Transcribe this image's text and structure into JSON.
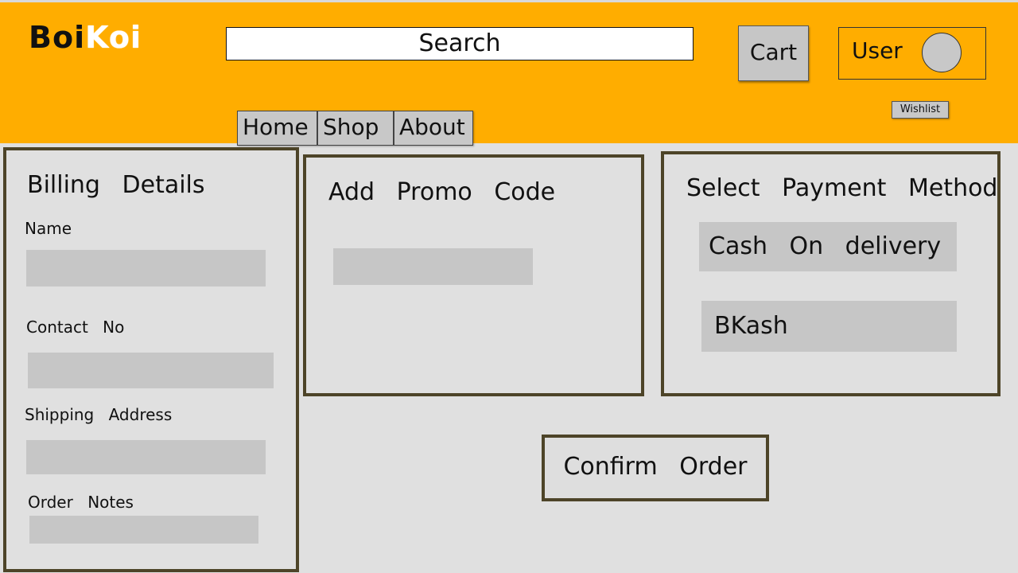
{
  "header": {
    "logo_part1": "Boi",
    "logo_part2": "Koi",
    "search_label": "Search",
    "cart_label": "Cart",
    "user_label": "User",
    "wishlist_label": "Wishlist",
    "nav": [
      "Home",
      "Shop",
      "About"
    ]
  },
  "billing": {
    "title": "Billing Details",
    "name_label": "Name",
    "contact_label": "Contact No",
    "address_label": "Shipping Address",
    "notes_label": "Order Notes"
  },
  "promo": {
    "title": "Add Promo Code"
  },
  "payment": {
    "title": "Select Payment Method",
    "options": [
      "Cash On delivery",
      "BKash"
    ]
  },
  "confirm_label": "Confirm Order",
  "colors": {
    "header_bg": "#ffad00",
    "page_bg": "#e0e0e0",
    "panel_border": "#4d4428",
    "field_bg": "#c6c6c6"
  }
}
